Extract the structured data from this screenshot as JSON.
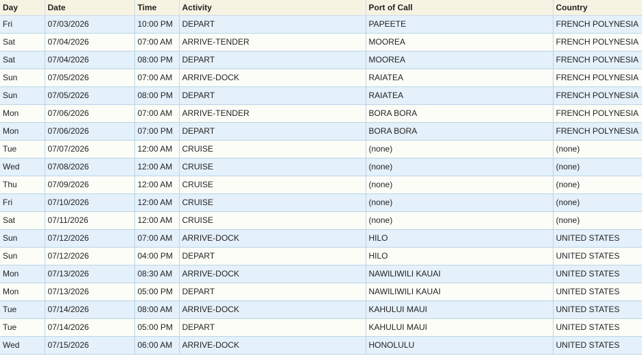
{
  "table": {
    "headers": [
      "Day",
      "Date",
      "Time",
      "Activity",
      "Port of Call",
      "Country"
    ],
    "rows": [
      [
        "Fri",
        "07/03/2026",
        "10:00 PM",
        "DEPART",
        "PAPEETE",
        "FRENCH POLYNESIA"
      ],
      [
        "Sat",
        "07/04/2026",
        "07:00 AM",
        "ARRIVE-TENDER",
        "MOOREA",
        "FRENCH POLYNESIA"
      ],
      [
        "Sat",
        "07/04/2026",
        "08:00 PM",
        "DEPART",
        "MOOREA",
        "FRENCH POLYNESIA"
      ],
      [
        "Sun",
        "07/05/2026",
        "07:00 AM",
        "ARRIVE-DOCK",
        "RAIATEA",
        "FRENCH POLYNESIA"
      ],
      [
        "Sun",
        "07/05/2026",
        "08:00 PM",
        "DEPART",
        "RAIATEA",
        "FRENCH POLYNESIA"
      ],
      [
        "Mon",
        "07/06/2026",
        "07:00 AM",
        "ARRIVE-TENDER",
        "BORA BORA",
        "FRENCH POLYNESIA"
      ],
      [
        "Mon",
        "07/06/2026",
        "07:00 PM",
        "DEPART",
        "BORA BORA",
        "FRENCH POLYNESIA"
      ],
      [
        "Tue",
        "07/07/2026",
        "12:00 AM",
        "CRUISE",
        "(none)",
        "(none)"
      ],
      [
        "Wed",
        "07/08/2026",
        "12:00 AM",
        "CRUISE",
        "(none)",
        "(none)"
      ],
      [
        "Thu",
        "07/09/2026",
        "12:00 AM",
        "CRUISE",
        "(none)",
        "(none)"
      ],
      [
        "Fri",
        "07/10/2026",
        "12:00 AM",
        "CRUISE",
        "(none)",
        "(none)"
      ],
      [
        "Sat",
        "07/11/2026",
        "12:00 AM",
        "CRUISE",
        "(none)",
        "(none)"
      ],
      [
        "Sun",
        "07/12/2026",
        "07:00 AM",
        "ARRIVE-DOCK",
        "HILO",
        "UNITED STATES"
      ],
      [
        "Sun",
        "07/12/2026",
        "04:00 PM",
        "DEPART",
        "HILO",
        "UNITED STATES"
      ],
      [
        "Mon",
        "07/13/2026",
        "08:30 AM",
        "ARRIVE-DOCK",
        "NAWILIWILI KAUAI",
        "UNITED STATES"
      ],
      [
        "Mon",
        "07/13/2026",
        "05:00 PM",
        "DEPART",
        "NAWILIWILI KAUAI",
        "UNITED STATES"
      ],
      [
        "Tue",
        "07/14/2026",
        "08:00 AM",
        "ARRIVE-DOCK",
        "KAHULUI MAUI",
        "UNITED STATES"
      ],
      [
        "Tue",
        "07/14/2026",
        "05:00 PM",
        "DEPART",
        "KAHULUI MAUI",
        "UNITED STATES"
      ],
      [
        "Wed",
        "07/15/2026",
        "06:00 AM",
        "ARRIVE-DOCK",
        "HONOLULU",
        "UNITED STATES"
      ]
    ]
  },
  "colors": {
    "header_bg": "#f7f3e3",
    "row_odd_bg": "#e4f0fa",
    "row_even_bg": "#fdfdf8",
    "grid_line": "#b9d5e6"
  }
}
